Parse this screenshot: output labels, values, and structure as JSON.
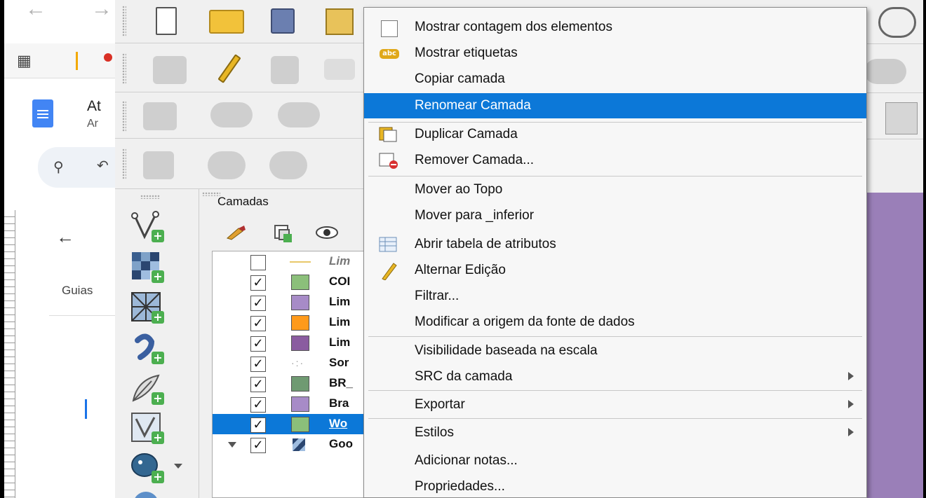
{
  "browser": {
    "doc_title": "At",
    "doc_subtitle": "Ar",
    "guides_label": "Guias",
    "back_arrow": "←"
  },
  "layers_panel": {
    "title": "Camadas",
    "layers": [
      {
        "name": "Lim",
        "checked": false,
        "color": "#ffffff",
        "italic": true
      },
      {
        "name": "COI",
        "checked": true,
        "color": "#8bbf7a"
      },
      {
        "name": "Lim",
        "checked": true,
        "color": "#a78bc7"
      },
      {
        "name": "Lim",
        "checked": true,
        "color": "#ff9a1a"
      },
      {
        "name": "Lim",
        "checked": true,
        "color": "#8a5ca0"
      },
      {
        "name": "Sor",
        "checked": true,
        "color": "#ffffff"
      },
      {
        "name": "BR_",
        "checked": true,
        "color": "#6f9a72"
      },
      {
        "name": "Bra",
        "checked": true,
        "color": "#a78bc7"
      },
      {
        "name": "Wo",
        "checked": true,
        "color": "#8bbf7a",
        "selected": true
      },
      {
        "name": "Goo",
        "checked": true,
        "color": "#5a7aa8"
      }
    ]
  },
  "context_menu": {
    "items": [
      {
        "label": "Mostrar contagem dos elementos",
        "icon": "checkbox-icon"
      },
      {
        "label": "Mostrar etiquetas",
        "icon": "label-abc-icon"
      },
      {
        "label": "Copiar camada"
      },
      {
        "label": "Renomear Camada",
        "highlighted": true
      },
      {
        "label": "Duplicar Camada",
        "icon": "duplicate-layer-icon"
      },
      {
        "label": "Remover Camada...",
        "icon": "remove-layer-icon"
      },
      {
        "label": "Mover ao Topo"
      },
      {
        "label": "Mover para _inferior"
      },
      {
        "label": "Abrir tabela de atributos",
        "icon": "attribute-table-icon"
      },
      {
        "label": "Alternar Edição",
        "icon": "pencil-icon"
      },
      {
        "label": "Filtrar..."
      },
      {
        "label": "Modificar a origem da fonte de dados"
      },
      {
        "label": "Visibilidade baseada na escala"
      },
      {
        "label": "SRC da camada",
        "submenu": true
      },
      {
        "label": "Exportar",
        "submenu": true
      },
      {
        "label": "Estilos",
        "submenu": true
      },
      {
        "label": "Adicionar notas..."
      },
      {
        "label": "Propriedades..."
      }
    ]
  },
  "colors": {
    "highlight": "#0c78d8",
    "map_background": "#9a7fb8"
  }
}
